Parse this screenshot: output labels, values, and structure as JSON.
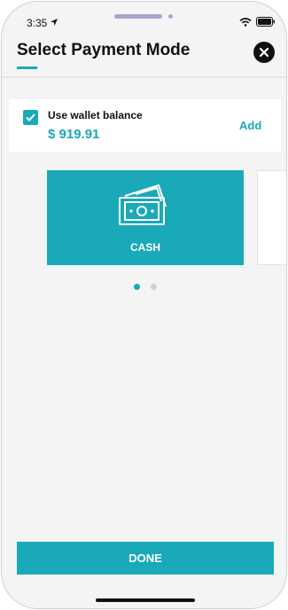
{
  "status_bar": {
    "time": "3:35"
  },
  "header": {
    "title": "Select Payment Mode"
  },
  "wallet": {
    "label": "Use wallet balance",
    "amount": "$ 919.91",
    "checked": true,
    "add_label": "Add"
  },
  "payment_modes": [
    {
      "label": "CASH",
      "icon": "cash-icon"
    }
  ],
  "pager": {
    "count": 2,
    "active": 0
  },
  "footer": {
    "done_label": "DONE"
  },
  "colors": {
    "accent": "#19a9b9",
    "background": "#f4f4f4"
  }
}
